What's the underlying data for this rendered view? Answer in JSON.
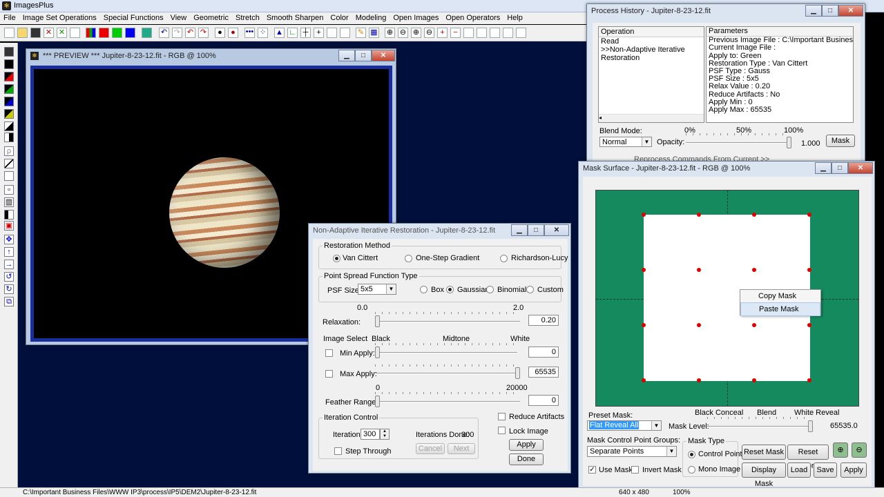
{
  "app": {
    "title": "ImagesPlus"
  },
  "menu": [
    "File",
    "Image Set Operations",
    "Special Functions",
    "View",
    "Geometric",
    "Stretch",
    "Smooth Sharpen",
    "Color",
    "Modeling",
    "Open Images",
    "Open Operators",
    "Help"
  ],
  "preview": {
    "title": "*** PREVIEW *** Jupiter-8-23-12.fit - RGB @ 100%"
  },
  "history": {
    "title": "Process History - Jupiter-8-23-12.fit",
    "op_header": "Operation",
    "param_header": "Parameters",
    "operations": [
      "Read",
      ">>Non-Adaptive Iterative Restoration"
    ],
    "parameters": [
      "Previous Image File : C:\\Important Business Files\\W",
      "Current Image File :",
      "Apply to:  Green",
      "Restoration Type : Van Cittert",
      "PSF Type : Gauss",
      "PSF Size : 5x5",
      "Relax Value :  0.20",
      "Reduce Artifacts : No",
      "Apply Min : 0",
      "Apply Max : 65535"
    ],
    "blend_label": "Blend Mode:",
    "blend_value": "Normal",
    "opacity_label": "Opacity:",
    "opacity_ticks": [
      "0%",
      "50%",
      "100%"
    ],
    "opacity_value": "1.000",
    "mask_button": "Mask",
    "hidden_text": "Reprocess Commands From Current >>"
  },
  "restore": {
    "title": "Non-Adaptive Iterative Restoration - Jupiter-8-23-12.fit",
    "method_group": "Restoration Method",
    "methods": [
      "Van Cittert",
      "One-Step Gradient",
      "Richardson-Lucy"
    ],
    "psf_group": "Point Spread Function Type",
    "psf_size_label": "PSF Size:",
    "psf_size": "5x5",
    "psf_types": [
      "Box",
      "Gaussian",
      "Binomial",
      "Custom"
    ],
    "relax_min": "0.0",
    "relax_max": "2.0",
    "relax_label": "Relaxation:",
    "relax_value": "0.20",
    "image_select": "Image Select",
    "black": "Black",
    "midtone": "Midtone",
    "white": "White",
    "min_apply": "Min Apply:",
    "min_value": "0",
    "max_apply": "Max Apply:",
    "max_value": "65535",
    "feather_min": "0",
    "feather_max": "20000",
    "feather_label": "Feather Range:",
    "feather_value": "0",
    "iter_group": "Iteration Control",
    "iter_label": "Iterations:",
    "iter_value": "300",
    "iter_done_label": "Iterations Done:",
    "iter_done": "300",
    "step_through": "Step Through",
    "cancel": "Cancel",
    "next": "Next",
    "reduce_artifacts": "Reduce Artifacts",
    "lock_image": "Lock Image",
    "apply": "Apply",
    "done": "Done"
  },
  "mask": {
    "title": "Mask Surface - Jupiter-8-23-12.fit - RGB @ 100%",
    "context_menu": [
      "Copy Mask",
      "Paste Mask"
    ],
    "preset_label": "Preset Mask:",
    "preset_value": "Flat Reveal All",
    "black_conceal": "Black Conceal",
    "blend": "Blend",
    "white_reveal": "White Reveal",
    "mask_level_label": "Mask Level:",
    "mask_level_value": "65535.0",
    "groups_label": "Mask Control Point Groups:",
    "groups_value": "Separate Points",
    "mask_type": "Mask Type",
    "control_point": "Control Point",
    "mono_image": "Mono Image",
    "use_mask": "Use Mask",
    "invert_mask": "Invert Mask",
    "reset_mask": "Reset Mask",
    "reset_zoom": "Reset Zoom",
    "display_mask": "Display Mask",
    "load": "Load",
    "save": "Save",
    "apply": "Apply"
  },
  "status": {
    "path": "C:\\Important Business Files\\WWW IP3\\process\\IP5\\DEM2\\Jupiter-8-23-12.fit",
    "size": "640 x 480",
    "zoom": "100%"
  },
  "colors": {
    "desktop": "#000f3c",
    "mask_green": "#158a5f",
    "point_red": "#e00000"
  }
}
